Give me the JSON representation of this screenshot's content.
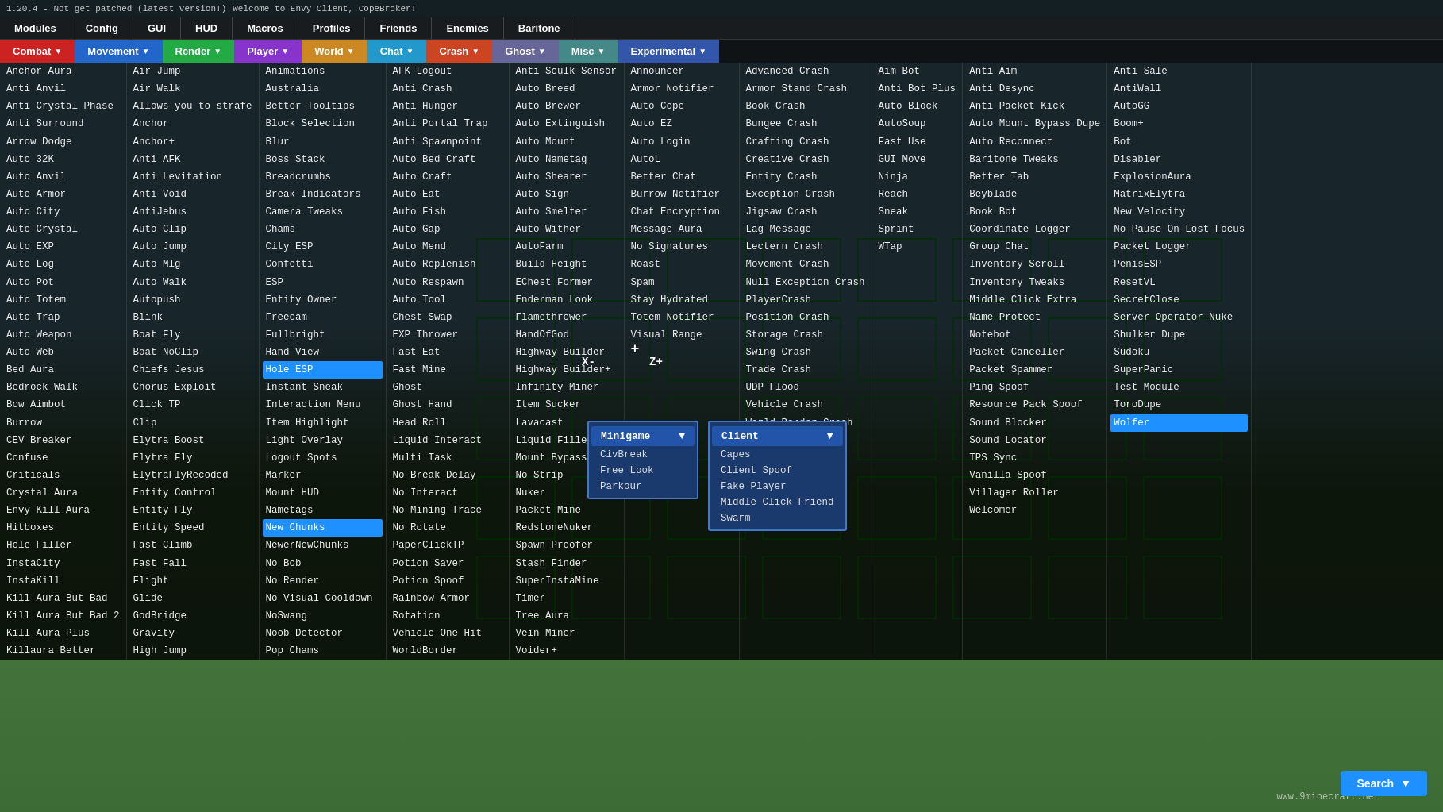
{
  "topbar": {
    "title": "Welcome to Envy Client, CopeBroker!",
    "version": "1.20.4 - Not get patched (latest version!)"
  },
  "navTabs": [
    {
      "id": "modules",
      "label": "Modules"
    },
    {
      "id": "config",
      "label": "Config"
    },
    {
      "id": "gui",
      "label": "GUI"
    },
    {
      "id": "hud",
      "label": "HUD"
    },
    {
      "id": "macros",
      "label": "Macros"
    },
    {
      "id": "profiles",
      "label": "Profiles"
    },
    {
      "id": "friends",
      "label": "Friends"
    },
    {
      "id": "enemies",
      "label": "Enemies"
    },
    {
      "id": "baritone",
      "label": "Baritone"
    }
  ],
  "categories": [
    {
      "id": "combat",
      "label": "Combat",
      "class": "combat"
    },
    {
      "id": "movement",
      "label": "Movement",
      "class": "movement"
    },
    {
      "id": "render",
      "label": "Render",
      "class": "render"
    },
    {
      "id": "player",
      "label": "Player",
      "class": "player"
    },
    {
      "id": "world",
      "label": "World",
      "class": "world"
    },
    {
      "id": "chat",
      "label": "Chat",
      "class": "chat"
    },
    {
      "id": "crash",
      "label": "Crash",
      "class": "crash"
    },
    {
      "id": "ghost",
      "label": "Ghost",
      "class": "ghost"
    },
    {
      "id": "misc",
      "label": "Misc",
      "class": "misc"
    },
    {
      "id": "experimental",
      "label": "Experimental",
      "class": "experimental"
    }
  ],
  "columns": {
    "combat": [
      "Anchor Aura",
      "Anti Anvil",
      "Anti Crystal Phase",
      "Anti Surround",
      "Arrow Dodge",
      "Auto 32K",
      "Auto Anvil",
      "Auto Armor",
      "Auto City",
      "Auto Crystal",
      "Auto EXP",
      "Auto Log",
      "Auto Pot",
      "Auto Totem",
      "Auto Trap",
      "Auto Weapon",
      "Auto Web",
      "Bed Aura",
      "Bedrock Walk",
      "Bow Aimbot",
      "Burrow",
      "CEV Breaker",
      "Confuse",
      "Criticals",
      "Crystal Aura",
      "Envy Kill Aura",
      "Hitboxes",
      "Hole Filler",
      "InstaCity",
      "InstaKill",
      "Kill Aura But Bad",
      "Kill Aura But Bad 2",
      "Kill Aura Plus",
      "Killaura Better"
    ],
    "movement": [
      "Air Jump",
      "Air Walk",
      "Allows you to strafe",
      "Anchor",
      "Anchor+",
      "Anti AFK",
      "Anti Levitation",
      "Anti Void",
      "AntiJebus",
      "Auto Clip",
      "Auto Jump",
      "Auto Mlg",
      "Auto Walk",
      "Autopush",
      "Blink",
      "Boat Fly",
      "Boat NoClip",
      "Chiefs Jesus",
      "Chorus Exploit",
      "Click TP",
      "Clip",
      "Elytra Boost",
      "Elytra Fly",
      "ElytraFlyRecoded",
      "Entity Control",
      "Entity Fly",
      "Entity Speed",
      "Fast Climb",
      "Fast Fall",
      "Flight",
      "Glide",
      "GodBridge",
      "Gravity",
      "High Jump"
    ],
    "render": [
      "Animations",
      "Australia",
      "Better Tooltips",
      "Block Selection",
      "Blur",
      "Boss Stack",
      "Breadcrumbs",
      "Break Indicators",
      "Camera Tweaks",
      "Chams",
      "City ESP",
      "Confetti",
      "ESP",
      "Entity Owner",
      "Freecam",
      "Fullbright",
      "Hand View",
      "Hole ESP",
      "Instant Sneak",
      "Interaction Menu",
      "Item Highlight",
      "Light Overlay",
      "Logout Spots",
      "Marker",
      "Mount HUD",
      "Nametags",
      "New Chunks",
      "NewerNewChunks",
      "No Bob",
      "No Render",
      "No Visual Cooldown",
      "NoSwang",
      "Noob Detector",
      "Pop Chams"
    ],
    "player": [
      "AFK Logout",
      "Anti Crash",
      "Anti Hunger",
      "Anti Portal Trap",
      "Anti Spawnpoint",
      "Auto Bed Craft",
      "Auto Craft",
      "Auto Eat",
      "Auto Fish",
      "Auto Gap",
      "Auto Mend",
      "Auto Replenish",
      "Auto Respawn",
      "Auto Tool",
      "Chest Swap",
      "EXP Thrower",
      "Fast Eat",
      "Fast Mine",
      "Ghost",
      "Ghost Hand",
      "Head Roll",
      "Liquid Interact",
      "Multi Task",
      "No Break Delay",
      "No Interact",
      "No Mining Trace",
      "No Rotate",
      "PaperClickTP",
      "Potion Saver",
      "Potion Spoof",
      "Rainbow Armor",
      "Rotation",
      "Vehicle One Hit",
      "WorldBorder"
    ],
    "world": [
      "Anti Sculk Sensor",
      "Auto Breed",
      "Auto Brewer",
      "Auto Extinguish",
      "Auto Mount",
      "Auto Nametag",
      "Auto Shearer",
      "Auto Sign",
      "Auto Smelter",
      "Auto Wither",
      "AutoFarm",
      "Build Height",
      "EChest Former",
      "Enderman Look",
      "Flamethrower",
      "HandOfGod",
      "Highway Builder",
      "Highway Builder+",
      "Infinity Miner",
      "Item Sucker",
      "Lavacast",
      "Liquid Filler",
      "Mount Bypass",
      "No Strip",
      "Nuker",
      "Packet Mine",
      "RedstoneNuker",
      "Spawn Proofer",
      "Stash Finder",
      "SuperInstaMine",
      "Timer",
      "Tree Aura",
      "Vein Miner",
      "Voider+"
    ],
    "chat": [
      "Announcer",
      "Armor Notifier",
      "Auto Cope",
      "Auto EZ",
      "Auto Login",
      "AutoL",
      "Better Chat",
      "Burrow Notifier",
      "Chat Encryption",
      "Message Aura",
      "No Signatures",
      "Roast",
      "Spam",
      "Stay Hydrated",
      "Totem Notifier",
      "Visual Range"
    ],
    "crash": [
      "Advanced Crash",
      "Armor Stand Crash",
      "Book Crash",
      "Bungee Crash",
      "Crafting Crash",
      "Creative Crash",
      "Entity Crash",
      "Exception Crash",
      "Jigsaw Crash",
      "Lag Message",
      "Lectern Crash",
      "Movement Crash",
      "Null Exception Crash",
      "PlayerCrash",
      "Position Crash",
      "Storage Crash",
      "Swing Crash",
      "Trade Crash",
      "UDP Flood",
      "Vehicle Crash",
      "World Border Crash"
    ],
    "ghost": [
      "Aim Bot",
      "Anti Bot Plus",
      "Auto Block",
      "AutoSoup",
      "Fast Use",
      "GUI Move",
      "Ninja",
      "Reach",
      "Sneak",
      "Sprint",
      "WTap"
    ],
    "misc": [
      "Anti Aim",
      "Anti Desync",
      "Anti Packet Kick",
      "Auto Mount Bypass Dupe",
      "Auto Reconnect",
      "Baritone Tweaks",
      "Better Tab",
      "Beyblade",
      "Book Bot",
      "Coordinate Logger",
      "Group Chat",
      "Inventory Scroll",
      "Inventory Tweaks",
      "Middle Click Extra",
      "Name Protect",
      "Notebot",
      "Packet Canceller",
      "Packet Spammer",
      "Ping Spoof",
      "Resource Pack Spoof",
      "Sound Blocker",
      "Sound Locator",
      "TPS Sync",
      "Vanilla Spoof",
      "Villager Roller",
      "Welcomer"
    ],
    "experimental": [
      "Anti Sale",
      "AntiWall",
      "AutoGG",
      "Boom+",
      "Bot",
      "Disabler",
      "ExplosionAura",
      "MatrixElytra",
      "New Velocity",
      "No Pause On Lost Focus",
      "Packet Logger",
      "PenisESP",
      "ResetVL",
      "SecretClose",
      "Server Operator Nuke",
      "Shulker Dupe",
      "Sudoku",
      "SuperPanic",
      "Test Module",
      "ToroDupe",
      "Wolfer"
    ],
    "minigame": {
      "header": "Minigame",
      "items": [
        "CivBreak",
        "Free Look",
        "Parkour"
      ]
    },
    "client": {
      "header": "Client",
      "items": [
        "Capes",
        "Client Spoof",
        "Fake Player",
        "Middle Click Friend",
        "Swarm"
      ]
    }
  },
  "selectedItems": [
    "Hole ESP",
    "New Chunks",
    "Wolfer"
  ],
  "search": {
    "label": "Search",
    "arrow": "▼"
  },
  "crosshair": "+",
  "zLabel": "Z+",
  "xLabel": "X-",
  "watermark": "www.9minecraft.net"
}
